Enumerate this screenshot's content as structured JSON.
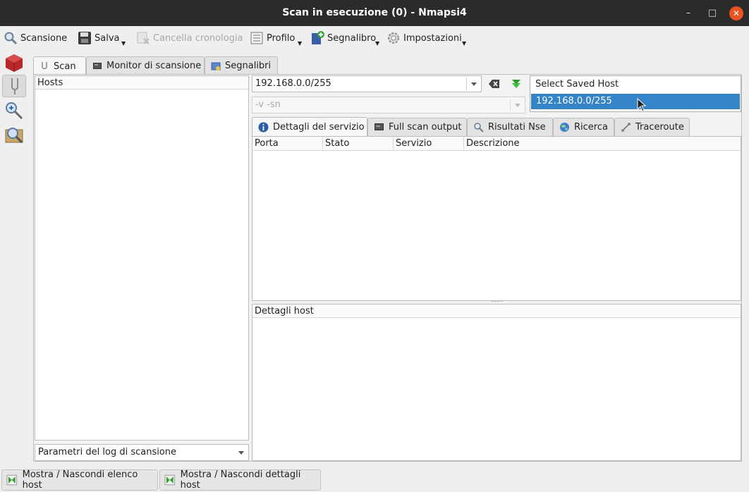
{
  "window": {
    "title": "Scan in esecuzione (0) - Nmapsi4"
  },
  "toolbar": {
    "scan": "Scansione",
    "save": "Salva",
    "clear_history": "Cancella cronologia",
    "profile": "Profilo",
    "bookmark": "Segnalibro",
    "settings": "Impostazioni"
  },
  "tabs": [
    "Scan",
    "Monitor di scansione",
    "Segnalibri"
  ],
  "hosts": {
    "header": "Hosts"
  },
  "log_combo": {
    "value": "Parametri del log di scansione"
  },
  "target": {
    "value": "192.168.0.0/255"
  },
  "options": {
    "value": "-v -sn"
  },
  "saved_host_popup": {
    "header": "Select Saved Host",
    "items": [
      "192.168.0.0/255"
    ]
  },
  "result_tabs": [
    "Dettagli del servizio",
    "Full scan output",
    "Risultati Nse",
    "Ricerca",
    "Traceroute"
  ],
  "services_table": {
    "columns": [
      "Porta",
      "Stato",
      "Servizio",
      "Descrizione"
    ]
  },
  "host_details": {
    "header": "Dettagli host"
  },
  "bottom": {
    "toggle_hosts": "Mostra / Nascondi elenco host",
    "toggle_details": "Mostra / Nascondi dettagli host"
  },
  "colors": {
    "titlebar": "#2b2b2b",
    "close": "#e95420",
    "selection": "#3584c8"
  }
}
